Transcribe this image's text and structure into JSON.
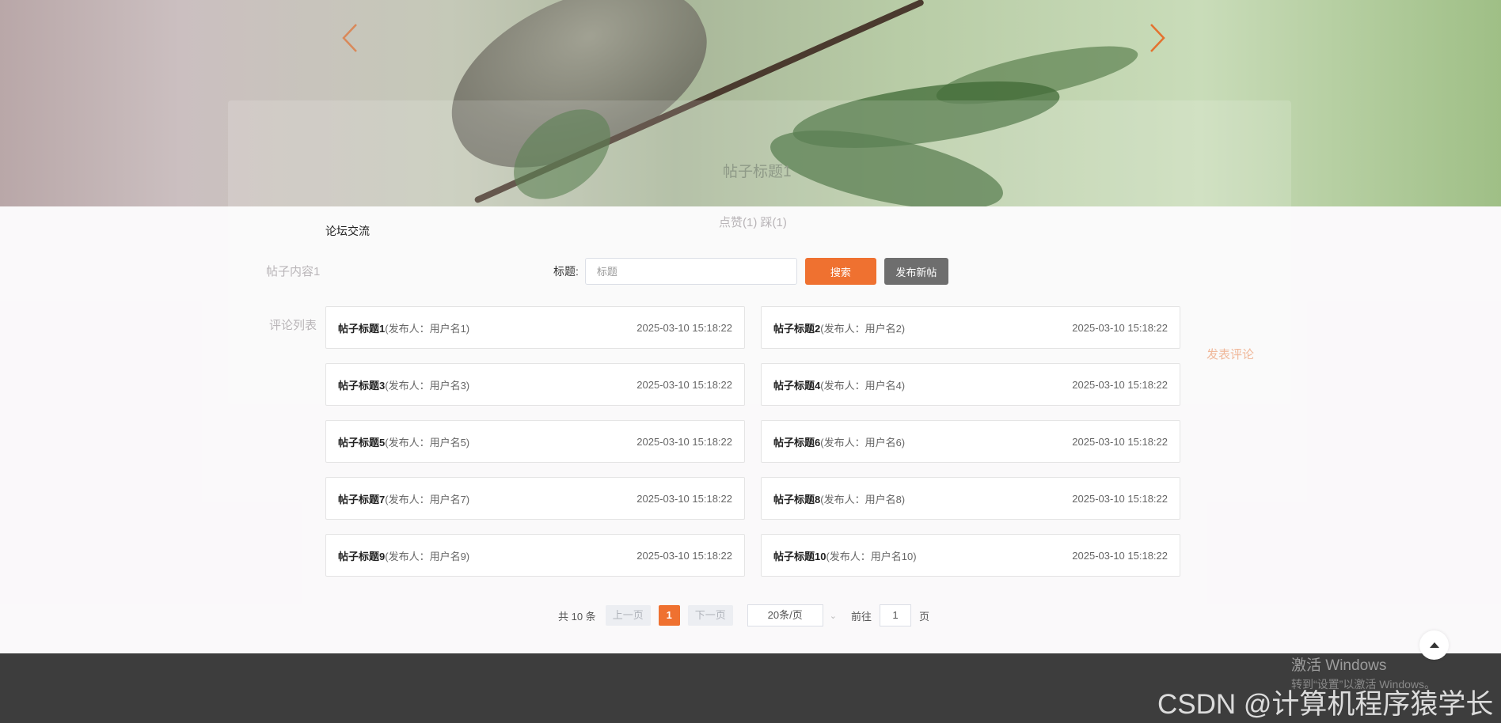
{
  "colors": {
    "accent": "#ef7130",
    "secondary_button": "#6e6e6e",
    "footer": "#3d3d3d"
  },
  "banner": {
    "prev_icon": "chevron-left-icon",
    "next_icon": "chevron-right-icon"
  },
  "ghost": {
    "title": "帖子标题1",
    "votes": "点赞(1)  踩(1)",
    "content": "帖子内容1",
    "comments": "评论列表",
    "comment_button": "发表评论"
  },
  "page_title": "论坛交流",
  "search": {
    "label": "标题:",
    "placeholder": "标题",
    "value": "",
    "search_button": "搜索",
    "new_post_button": "发布新帖"
  },
  "posts": [
    {
      "title": "帖子标题1",
      "author": "(发布人：用户名1)",
      "date": "2025-03-10 15:18:22"
    },
    {
      "title": "帖子标题2",
      "author": "(发布人：用户名2)",
      "date": "2025-03-10 15:18:22"
    },
    {
      "title": "帖子标题3",
      "author": "(发布人：用户名3)",
      "date": "2025-03-10 15:18:22"
    },
    {
      "title": "帖子标题4",
      "author": "(发布人：用户名4)",
      "date": "2025-03-10 15:18:22"
    },
    {
      "title": "帖子标题5",
      "author": "(发布人：用户名5)",
      "date": "2025-03-10 15:18:22"
    },
    {
      "title": "帖子标题6",
      "author": "(发布人：用户名6)",
      "date": "2025-03-10 15:18:22"
    },
    {
      "title": "帖子标题7",
      "author": "(发布人：用户名7)",
      "date": "2025-03-10 15:18:22"
    },
    {
      "title": "帖子标题8",
      "author": "(发布人：用户名8)",
      "date": "2025-03-10 15:18:22"
    },
    {
      "title": "帖子标题9",
      "author": "(发布人：用户名9)",
      "date": "2025-03-10 15:18:22"
    },
    {
      "title": "帖子标题10",
      "author": "(发布人：用户名10)",
      "date": "2025-03-10 15:18:22"
    }
  ],
  "pagination": {
    "total": "共 10 条",
    "prev": "上一页",
    "current": "1",
    "next": "下一页",
    "page_size": "20条/页",
    "goto_label": "前往",
    "goto_value": "1",
    "page_suffix": "页"
  },
  "watermark": {
    "line1": "激活 Windows",
    "line2": "转到“设置”以激活 Windows。",
    "csdn": "CSDN @计算机程序猿学长"
  }
}
